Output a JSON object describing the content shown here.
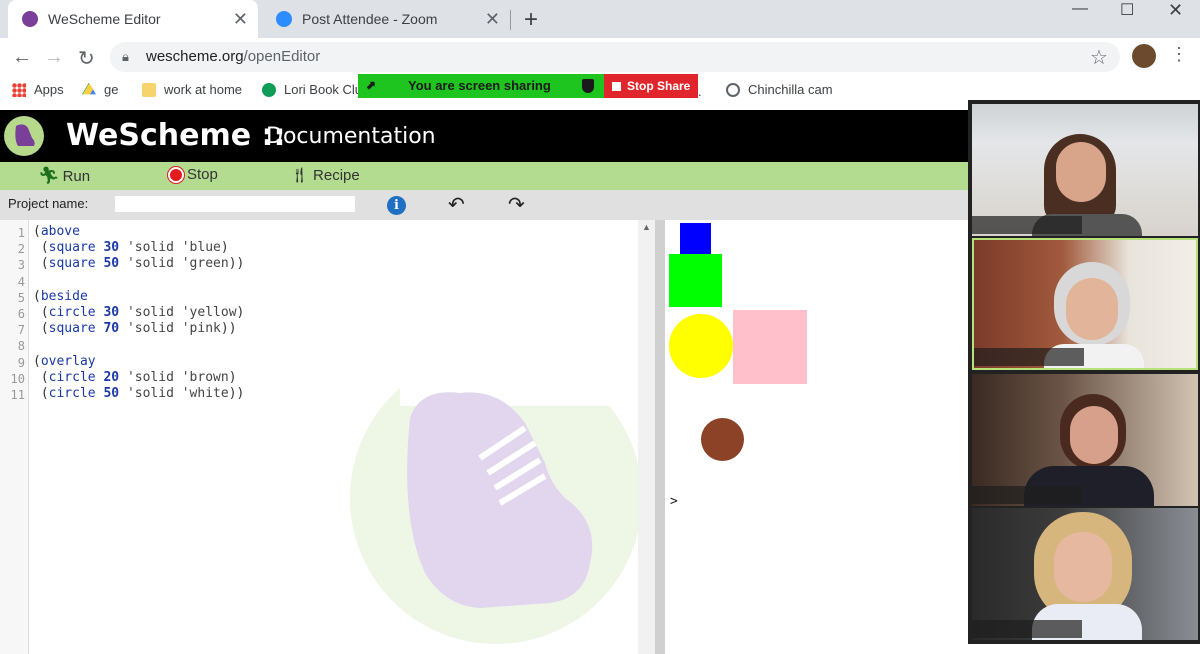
{
  "browser": {
    "tabs": [
      {
        "title": "WeScheme Editor",
        "active": true
      },
      {
        "title": "Post Attendee - Zoom",
        "active": false
      }
    ],
    "url_host": "wescheme.org",
    "url_path": "/openEditor",
    "bookmarks": [
      {
        "label": "Apps",
        "icon": "apps-grid-icon"
      },
      {
        "label": "ge",
        "icon": "google-drive-icon"
      },
      {
        "label": "work at home",
        "icon": "folder-icon"
      },
      {
        "label": "Lori Book Clu",
        "icon": "hangouts-icon"
      },
      {
        "label": "Chinchilla cam",
        "icon": "globe-icon"
      }
    ]
  },
  "screen_share": {
    "banner_text": "You are screen sharing",
    "stop_label": "Stop Share"
  },
  "wescheme": {
    "title": "WeScheme ::",
    "subtitle": "Documentation",
    "toolbar": {
      "run": "Run",
      "stop": "Stop",
      "recipe": "Recipe"
    },
    "project_label": "Project name:",
    "project_value": "",
    "code_lines": [
      {
        "n": "1",
        "tokens": [
          [
            "p",
            "("
          ],
          [
            "kw",
            "above"
          ]
        ]
      },
      {
        "n": "2",
        "tokens": [
          [
            "p",
            " ("
          ],
          [
            "kw",
            "square"
          ],
          [
            "p",
            " "
          ],
          [
            "num",
            "30"
          ],
          [
            "p",
            " "
          ],
          [
            "sym",
            "'solid"
          ],
          [
            "p",
            " "
          ],
          [
            "sym",
            "'blue"
          ],
          [
            "p",
            ")"
          ]
        ]
      },
      {
        "n": "3",
        "tokens": [
          [
            "p",
            " ("
          ],
          [
            "kw",
            "square"
          ],
          [
            "p",
            " "
          ],
          [
            "num",
            "50"
          ],
          [
            "p",
            " "
          ],
          [
            "sym",
            "'solid"
          ],
          [
            "p",
            " "
          ],
          [
            "sym",
            "'green"
          ],
          [
            "p",
            "))"
          ]
        ]
      },
      {
        "n": "4",
        "tokens": []
      },
      {
        "n": "5",
        "tokens": [
          [
            "p",
            "("
          ],
          [
            "kw",
            "beside"
          ]
        ]
      },
      {
        "n": "6",
        "tokens": [
          [
            "p",
            " ("
          ],
          [
            "kw",
            "circle"
          ],
          [
            "p",
            " "
          ],
          [
            "num",
            "30"
          ],
          [
            "p",
            " "
          ],
          [
            "sym",
            "'solid"
          ],
          [
            "p",
            " "
          ],
          [
            "sym",
            "'yellow"
          ],
          [
            "p",
            ")"
          ]
        ]
      },
      {
        "n": "7",
        "tokens": [
          [
            "p",
            " ("
          ],
          [
            "kw",
            "square"
          ],
          [
            "p",
            " "
          ],
          [
            "num",
            "70"
          ],
          [
            "p",
            " "
          ],
          [
            "sym",
            "'solid"
          ],
          [
            "p",
            " "
          ],
          [
            "sym",
            "'pink"
          ],
          [
            "p",
            "))"
          ]
        ]
      },
      {
        "n": "8",
        "tokens": []
      },
      {
        "n": "9",
        "tokens": [
          [
            "p",
            "("
          ],
          [
            "kw",
            "overlay"
          ]
        ]
      },
      {
        "n": "10",
        "tokens": [
          [
            "p",
            " ("
          ],
          [
            "kw",
            "circle"
          ],
          [
            "p",
            " "
          ],
          [
            "num",
            "20"
          ],
          [
            "p",
            " "
          ],
          [
            "sym",
            "'solid"
          ],
          [
            "p",
            " "
          ],
          [
            "sym",
            "'brown"
          ],
          [
            "p",
            ")"
          ]
        ]
      },
      {
        "n": "11",
        "tokens": [
          [
            "p",
            " ("
          ],
          [
            "kw",
            "circle"
          ],
          [
            "p",
            " "
          ],
          [
            "num",
            "50"
          ],
          [
            "p",
            " "
          ],
          [
            "sym",
            "'solid"
          ],
          [
            "p",
            " "
          ],
          [
            "sym",
            "'white"
          ],
          [
            "p",
            "))"
          ]
        ]
      }
    ],
    "prompt": ">",
    "output_colors": {
      "blue": "#0000ff",
      "green": "#00ff00",
      "yellow": "#ffff00",
      "pink": "#ffc0cb",
      "brown": "#8b4226"
    }
  },
  "zoom": {
    "participants": 4
  }
}
